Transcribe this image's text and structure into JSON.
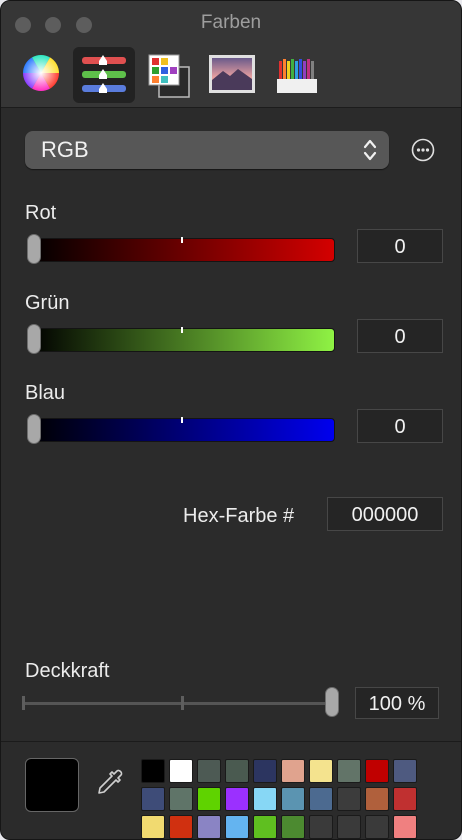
{
  "window": {
    "title": "Farben"
  },
  "toolbar": {
    "items": [
      {
        "icon": "color-wheel-icon"
      },
      {
        "icon": "sliders-icon"
      },
      {
        "icon": "color-palettes-icon"
      },
      {
        "icon": "image-palettes-icon"
      },
      {
        "icon": "pencils-icon"
      }
    ],
    "selected_index": 1
  },
  "model_select": {
    "value": "RGB"
  },
  "sliders": [
    {
      "label": "Rot",
      "value": "0",
      "level": 0,
      "color": "#d40000"
    },
    {
      "label": "Grün",
      "value": "0",
      "level": 0,
      "color": "#8ff244"
    },
    {
      "label": "Blau",
      "value": "0",
      "level": 0,
      "color": "#0000ee"
    }
  ],
  "hex": {
    "label": "Hex-Farbe #",
    "value": "000000"
  },
  "opacity": {
    "label": "Deckkraft",
    "value": "100 %",
    "level": 1.0
  },
  "current_color": "#000000",
  "palette": [
    "#000000",
    "#ffffff",
    "#4d5a54",
    "#4a5a50",
    "#2c3560",
    "#e0a38e",
    "#f4e38e",
    "#627468",
    "#c00000",
    "#4e5a80",
    "#3e4c78",
    "#5f7468",
    "#5fd300",
    "#9b30ff",
    "#87d7f5",
    "#5b94b1",
    "#4c6a90",
    "#3c3c3c",
    "#b0603c",
    "#c03030",
    "#f1da70",
    "#d03010",
    "#8a84c4",
    "#64b4f0",
    "#5fbf20",
    "#4c8a30",
    "#3a3a3a",
    "#3a3a3a",
    "#3a3a3a",
    "#f08080"
  ]
}
